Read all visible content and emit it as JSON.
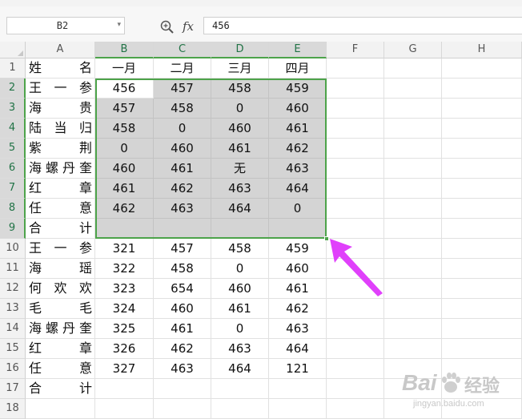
{
  "formula_bar": {
    "name_box": "B2",
    "formula": "456"
  },
  "columns": [
    "A",
    "B",
    "C",
    "D",
    "E",
    "F",
    "G",
    "H"
  ],
  "rows": [
    {
      "num": "1",
      "name": [
        "姓",
        "名"
      ],
      "values": [
        "一月",
        "二月",
        "三月",
        "四月"
      ]
    },
    {
      "num": "2",
      "name": [
        "王",
        "一",
        "参"
      ],
      "values": [
        "456",
        "457",
        "458",
        "459"
      ]
    },
    {
      "num": "3",
      "name": [
        "海",
        "贵"
      ],
      "values": [
        "457",
        "458",
        "0",
        "460"
      ]
    },
    {
      "num": "4",
      "name": [
        "陆",
        "当",
        "归"
      ],
      "values": [
        "458",
        "0",
        "460",
        "461"
      ]
    },
    {
      "num": "5",
      "name": [
        "紫",
        "荆"
      ],
      "values": [
        "0",
        "460",
        "461",
        "462"
      ]
    },
    {
      "num": "6",
      "name": [
        "海",
        "螺",
        "丹",
        "奎"
      ],
      "values": [
        "460",
        "461",
        "无",
        "463"
      ]
    },
    {
      "num": "7",
      "name": [
        "红",
        "章"
      ],
      "values": [
        "461",
        "462",
        "463",
        "464"
      ]
    },
    {
      "num": "8",
      "name": [
        "任",
        "意"
      ],
      "values": [
        "462",
        "463",
        "464",
        "0"
      ]
    },
    {
      "num": "9",
      "name": [
        "合",
        "计"
      ],
      "values": [
        "",
        "",
        "",
        ""
      ]
    },
    {
      "num": "10",
      "name": [
        "王",
        "一",
        "参"
      ],
      "values": [
        "321",
        "457",
        "458",
        "459"
      ]
    },
    {
      "num": "11",
      "name": [
        "海",
        "瑶"
      ],
      "values": [
        "322",
        "458",
        "0",
        "460"
      ]
    },
    {
      "num": "12",
      "name": [
        "何",
        "欢",
        "欢"
      ],
      "values": [
        "323",
        "654",
        "460",
        "461"
      ]
    },
    {
      "num": "13",
      "name": [
        "毛",
        "毛"
      ],
      "values": [
        "324",
        "460",
        "461",
        "462"
      ]
    },
    {
      "num": "14",
      "name": [
        "海",
        "螺",
        "丹",
        "奎"
      ],
      "values": [
        "325",
        "461",
        "0",
        "463"
      ]
    },
    {
      "num": "15",
      "name": [
        "红",
        "章"
      ],
      "values": [
        "326",
        "462",
        "463",
        "464"
      ]
    },
    {
      "num": "16",
      "name": [
        "任",
        "意"
      ],
      "values": [
        "327",
        "463",
        "464",
        "121"
      ]
    },
    {
      "num": "17",
      "name": [
        "合",
        "计"
      ],
      "values": [
        "",
        "",
        "",
        ""
      ]
    },
    {
      "num": "18",
      "name": [],
      "values": [
        "",
        "",
        "",
        ""
      ]
    }
  ],
  "selection": {
    "range": "B2:E9",
    "active_cell": "B2"
  },
  "colors": {
    "selection_border": "#4da34a",
    "selection_fill": "#d4d4d4",
    "annotation_arrow": "#e040fb"
  },
  "icons": {
    "zoom": "magnifier-zoom-icon",
    "fx": "function-fx-icon",
    "arrow": "pointer-arrow-annotation"
  },
  "watermark": {
    "brand": "Bai",
    "brand_cn": "经验",
    "url": "jingyan.baidu.com"
  }
}
